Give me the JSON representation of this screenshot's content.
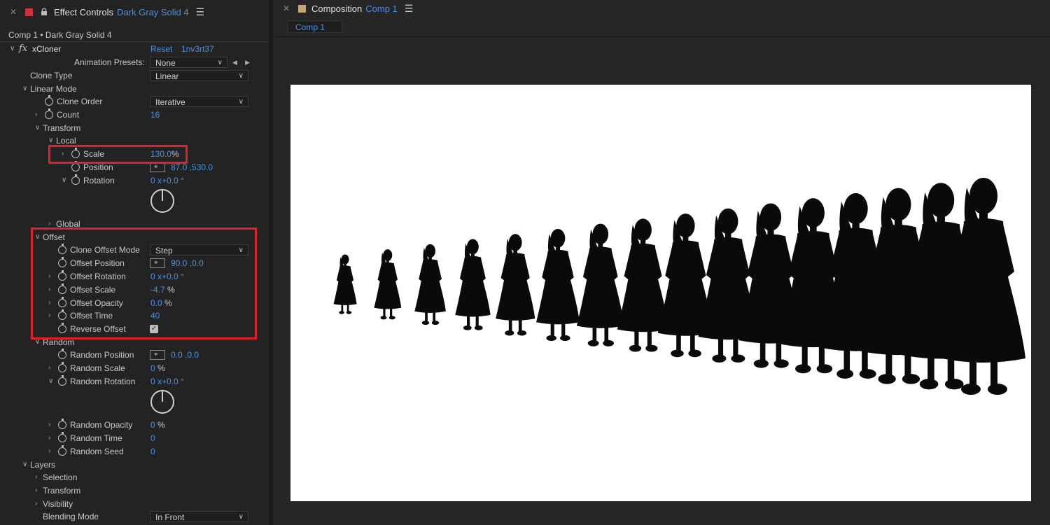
{
  "effect_controls": {
    "tab_title": "Effect Controls",
    "tab_layer": "Dark Gray Solid 4",
    "subtitle": "Comp 1 • Dark Gray Solid 4",
    "effect_name": "xCloner",
    "reset": "Reset",
    "plugin_id": "1nv3rt37",
    "animation_presets_label": "Animation Presets:",
    "animation_presets_value": "None",
    "clone_type_label": "Clone Type",
    "clone_type_value": "Linear",
    "linear_mode": "Linear Mode",
    "clone_order_label": "Clone Order",
    "clone_order_value": "Iterative",
    "count_label": "Count",
    "count_value": "16",
    "transform": "Transform",
    "local": "Local",
    "scale_label": "Scale",
    "scale_value": "130.0",
    "percent": "%",
    "position_label": "Position",
    "position_value": "87.0 ,530.0",
    "rotation_label": "Rotation",
    "rotation_value": "0 x+0.0 °",
    "global": "Global",
    "offset": "Offset",
    "clone_offset_mode_label": "Clone Offset Mode",
    "clone_offset_mode_value": "Step",
    "offset_position_label": "Offset Position",
    "offset_position_value": "90.0 ,0.0",
    "offset_rotation_label": "Offset Rotation",
    "offset_rotation_value": "0 x+0.0 °",
    "offset_scale_label": "Offset Scale",
    "offset_scale_value": "-4.7",
    "offset_opacity_label": "Offset Opacity",
    "offset_opacity_value": "0.0",
    "offset_time_label": "Offset Time",
    "offset_time_value": "40",
    "reverse_offset_label": "Reverse Offset",
    "reverse_offset_checked": true,
    "random": "Random",
    "random_position_label": "Random Position",
    "random_position_value": "0.0 ,0.0",
    "random_scale_label": "Random Scale",
    "random_scale_value": "0",
    "random_rotation_label": "Random Rotation",
    "random_rotation_value": "0 x+0.0 °",
    "random_opacity_label": "Random Opacity",
    "random_opacity_value": "0",
    "random_time_label": "Random Time",
    "random_time_value": "0",
    "random_seed_label": "Random Seed",
    "random_seed_value": "0",
    "layers": "Layers",
    "selection": "Selection",
    "layers_transform": "Transform",
    "visibility": "Visibility",
    "blending_mode_label": "Blending Mode",
    "blending_mode_value": "In Front"
  },
  "composition": {
    "tab_title": "Composition",
    "tab_comp": "Comp 1",
    "subtab": "Comp 1",
    "clone_count": 16
  },
  "colors": {
    "accent": "#4a90e2",
    "highlight": "#e0202a",
    "layer_chip": "#c9343a",
    "comp_chip": "#c8a67a"
  }
}
